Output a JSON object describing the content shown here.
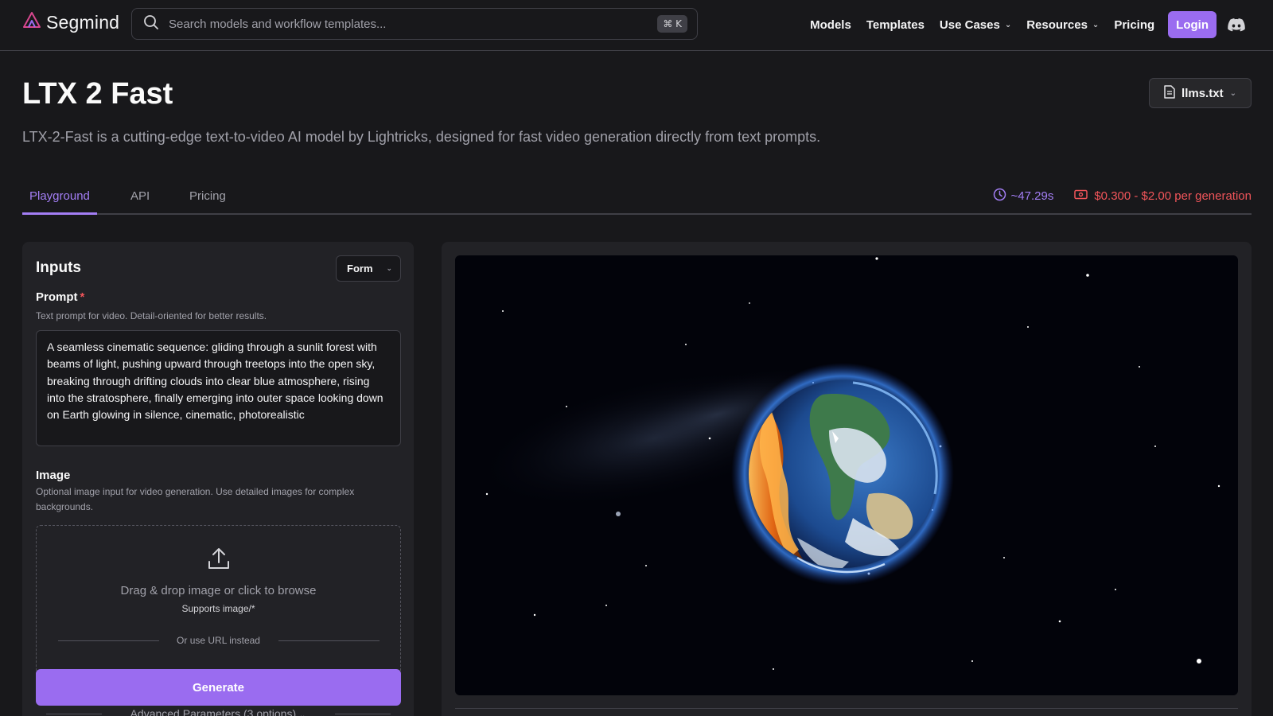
{
  "brand": {
    "name": "Segmind",
    "accent": "#9a6cf0"
  },
  "search": {
    "placeholder": "Search models and workflow templates...",
    "shortcut": "⌘ K"
  },
  "nav": {
    "items": [
      "Models",
      "Templates",
      "Use Cases",
      "Resources",
      "Pricing"
    ],
    "login_label": "Login"
  },
  "header": {
    "title": "LTX 2 Fast",
    "llms_label": "llms.txt",
    "description": "LTX-2-Fast is a cutting-edge text-to-video AI model by Lightricks, designed for fast video generation directly from text prompts."
  },
  "tabs": {
    "items": [
      "Playground",
      "API",
      "Pricing"
    ],
    "active": "Playground",
    "time": "~47.29s",
    "price": "$0.300 - $2.00 per generation"
  },
  "inputs": {
    "title": "Inputs",
    "mode_select": "Form",
    "prompt": {
      "label": "Prompt",
      "required_mark": "*",
      "help": "Text prompt for video. Detail-oriented for better results.",
      "value": "A seamless cinematic sequence: gliding through a sunlit forest with beams of light, pushing upward through treetops into the open sky, breaking through drifting clouds into clear blue atmosphere, rising into the stratosphere, finally emerging into outer space looking down on Earth glowing in silence, cinematic, photorealistic"
    },
    "image": {
      "label": "Image",
      "help": "Optional image input for video generation. Use detailed images for complex backgrounds.",
      "drop_text": "Drag & drop image or click to browse",
      "drop_sub": "Supports image/*",
      "url_text": "Or use URL instead"
    },
    "generate_label": "Generate",
    "advanced_label": "Advanced Parameters (3 options)"
  },
  "colors": {
    "background": "#18181b",
    "panel": "#222226",
    "accent_purple": "#a37ef5",
    "price_red": "#f2555a"
  }
}
